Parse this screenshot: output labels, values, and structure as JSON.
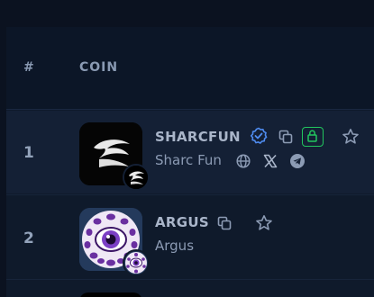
{
  "columns": {
    "rank": "#",
    "coin": "COIN"
  },
  "rows": [
    {
      "rank": "1",
      "symbol": "SHARCFUN",
      "name": "Sharc Fun",
      "icons": [
        "verified-badge-icon",
        "copy-icon",
        "lock-icon",
        "star-icon",
        "globe-icon",
        "x-icon",
        "telegram-icon"
      ]
    },
    {
      "rank": "2",
      "symbol": "ARGUS",
      "name": "Argus",
      "icons": [
        "copy-icon",
        "star-icon"
      ]
    }
  ],
  "colors": {
    "verified": "#4f8cf0",
    "lock": "#22c55e",
    "text": "#a9b5c9"
  }
}
